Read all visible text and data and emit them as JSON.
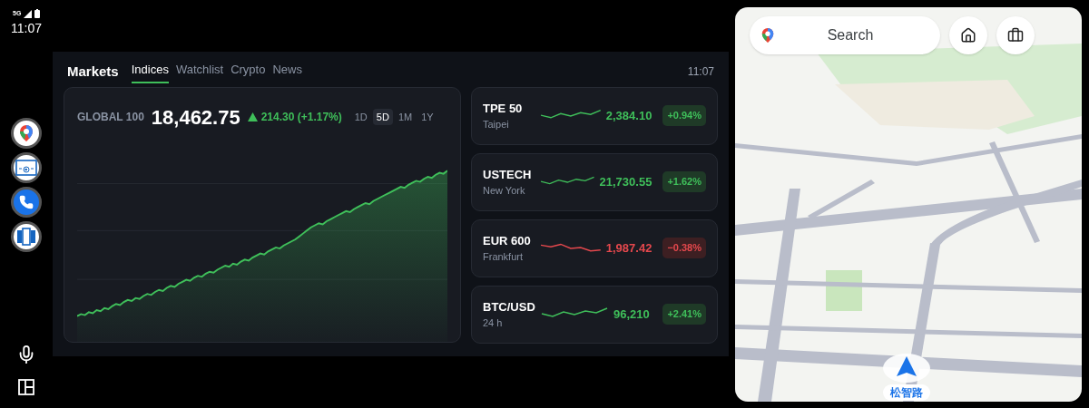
{
  "status_bar": {
    "network": "5G",
    "time": "11:07"
  },
  "markets": {
    "title": "Markets",
    "time": "11:07",
    "tabs": [
      {
        "label": "Indices",
        "selected": true
      },
      {
        "label": "Watchlist",
        "selected": false
      },
      {
        "label": "Crypto",
        "selected": false
      },
      {
        "label": "News",
        "selected": false
      }
    ],
    "main_index": {
      "name": "GLOBAL 100",
      "value": "18,462.75",
      "change": "214.30 (+1.17%)",
      "kind": "up",
      "ranges": [
        {
          "label": "1D",
          "selected": false
        },
        {
          "label": "5D",
          "selected": true
        },
        {
          "label": "1M",
          "selected": false
        },
        {
          "label": "1Y",
          "selected": false
        }
      ]
    },
    "tickers": [
      {
        "symbol": "TPE 50",
        "place": "Taipei",
        "price": "2,384.10",
        "change": "+0.94%",
        "kind": "up"
      },
      {
        "symbol": "USTECH",
        "place": "New York",
        "price": "21,730.55",
        "change": "+1.62%",
        "kind": "up"
      },
      {
        "symbol": "EUR 600",
        "place": "Frankfurt",
        "price": "1,987.42",
        "change": "−0.38%",
        "kind": "down"
      },
      {
        "symbol": "BTC/USD",
        "place": "24 h",
        "price": "96,210",
        "change": "+2.41%",
        "kind": "up"
      }
    ]
  },
  "map": {
    "search_label": "Search",
    "current_street": "松智路"
  }
}
